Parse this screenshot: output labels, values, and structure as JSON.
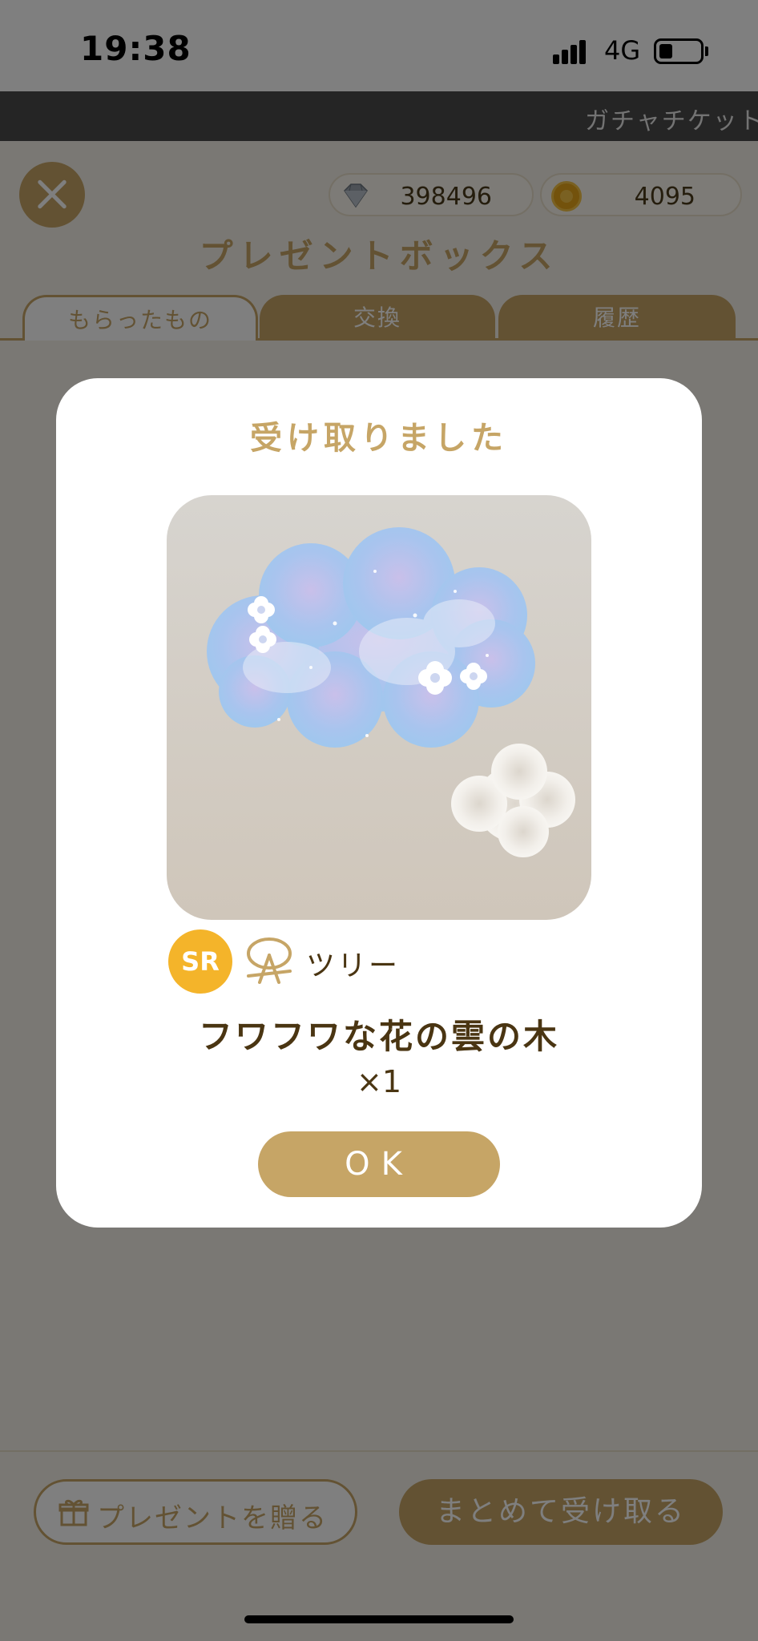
{
  "status_bar": {
    "time": "19:38",
    "network": "4G"
  },
  "ticker": {
    "text": "ガチャチケット"
  },
  "header": {
    "title": "プレゼントボックス",
    "gems": "398496",
    "coins": "4095"
  },
  "tabs": [
    {
      "label": "もらったもの",
      "active": true
    },
    {
      "label": "交換",
      "active": false
    },
    {
      "label": "履歴",
      "active": false
    }
  ],
  "bottom_bar": {
    "send_present_label": "プレゼントを贈る",
    "receive_all_label": "まとめて受け取る"
  },
  "modal": {
    "title": "受け取りました",
    "rarity": "SR",
    "category": "ツリー",
    "item_name": "フワフワな花の雲の木",
    "quantity": "×1",
    "ok_label": "OK"
  },
  "icons": {
    "close": "close-icon",
    "gem": "diamond-icon",
    "coin": "coin-icon",
    "gift": "gift-icon",
    "category": "tree-category-icon"
  },
  "colors": {
    "accent": "#c6a566",
    "rarity_sr": "#f4b42a",
    "text_dark": "#4a3512"
  }
}
